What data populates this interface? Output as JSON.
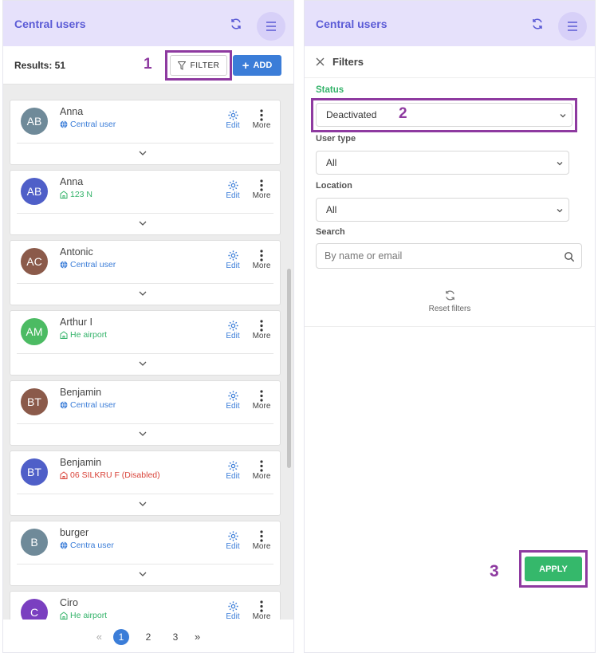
{
  "left": {
    "title": "Central users",
    "results": "Results: 51",
    "filter_label": "FILTER",
    "add_label": "ADD",
    "annotation": "1",
    "users": [
      {
        "initials": "AB",
        "name": "Anna",
        "subtitle": "Central user",
        "kind": "central",
        "avatar_color": "#6f8a99"
      },
      {
        "initials": "AB",
        "name": "Anna",
        "subtitle": "123 N",
        "kind": "location",
        "avatar_color": "#4f5fc8"
      },
      {
        "initials": "AC",
        "name": "Antonic",
        "subtitle": "Central user",
        "kind": "central",
        "avatar_color": "#8b5a4a"
      },
      {
        "initials": "AM",
        "name": "Arthur I",
        "subtitle": "He        airport",
        "kind": "location",
        "avatar_color": "#4cbb63"
      },
      {
        "initials": "BT",
        "name": "Benjamin",
        "subtitle": "Central user",
        "kind": "central",
        "avatar_color": "#8b5a4a"
      },
      {
        "initials": "BT",
        "name": "Benjamin",
        "subtitle": "06 SILKRU          F (Disabled)",
        "kind": "disabled",
        "avatar_color": "#4f5fc8"
      },
      {
        "initials": "B",
        "name": "burger",
        "subtitle": "Centra  user",
        "kind": "central",
        "avatar_color": "#6f8a99"
      },
      {
        "initials": "C",
        "name": "Ciro",
        "subtitle": "He        airport",
        "kind": "location",
        "avatar_color": "#7a3fc0"
      }
    ],
    "edit_label": "Edit",
    "more_label": "More",
    "pages": [
      "1",
      "2",
      "3"
    ],
    "prev": "«",
    "next": "»"
  },
  "right": {
    "title": "Central users",
    "filters_title": "Filters",
    "status_label": "Status",
    "status_value": "Deactivated",
    "annotation_status": "2",
    "user_type_label": "User type",
    "user_type_value": "All",
    "location_label": "Location",
    "location_value": "All",
    "search_label": "Search",
    "search_placeholder": "By name or email",
    "reset_label": "Reset filters",
    "apply_label": "APPLY",
    "annotation_apply": "3"
  },
  "colors": {
    "accent": "#3b7dd8",
    "header_bg": "#e6e1fb",
    "annotation": "#8e3aa0",
    "apply": "#35b86b",
    "disabled": "#d9443a",
    "location": "#34b36a",
    "central": "#3b7dd8"
  }
}
